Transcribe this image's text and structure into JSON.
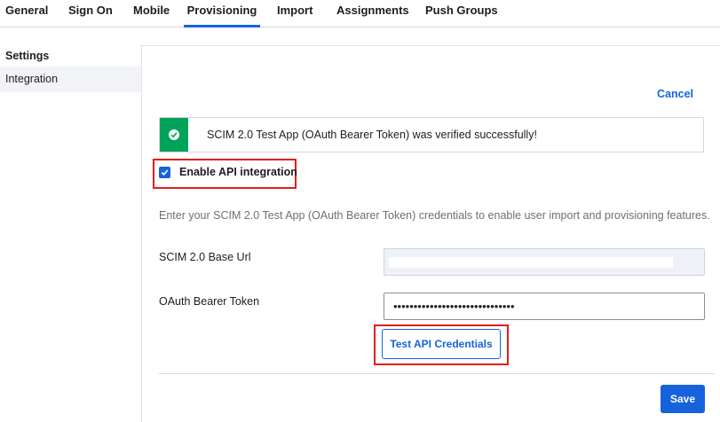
{
  "tabs": [
    {
      "label": "General",
      "active": false
    },
    {
      "label": "Sign On",
      "active": false
    },
    {
      "label": "Mobile",
      "active": false
    },
    {
      "label": "Provisioning",
      "active": true
    },
    {
      "label": "Import",
      "active": false
    },
    {
      "label": "Assignments",
      "active": false
    },
    {
      "label": "Push Groups",
      "active": false
    }
  ],
  "sidebar": {
    "heading": "Settings",
    "items": [
      {
        "label": "Integration",
        "selected": true
      }
    ]
  },
  "main": {
    "cancel_label": "Cancel",
    "alert": {
      "status": "success",
      "message": "SCIM 2.0 Test App (OAuth Bearer Token) was verified successfully!"
    },
    "enable_api": {
      "label": "Enable API integration",
      "checked": true
    },
    "description": "Enter your SCIM 2.0 Test App (OAuth Bearer Token) credentials to enable user import and provisioning features.",
    "fields": {
      "base_url": {
        "label": "SCIM 2.0 Base Url",
        "value": ""
      },
      "token": {
        "label": "OAuth Bearer Token",
        "value": "••••••••••••••••••••••••••••••"
      }
    },
    "test_button_label": "Test API Credentials",
    "save_label": "Save"
  },
  "colors": {
    "accent": "#1662dd",
    "success": "#00a35a",
    "highlight": "#e11d1d"
  }
}
